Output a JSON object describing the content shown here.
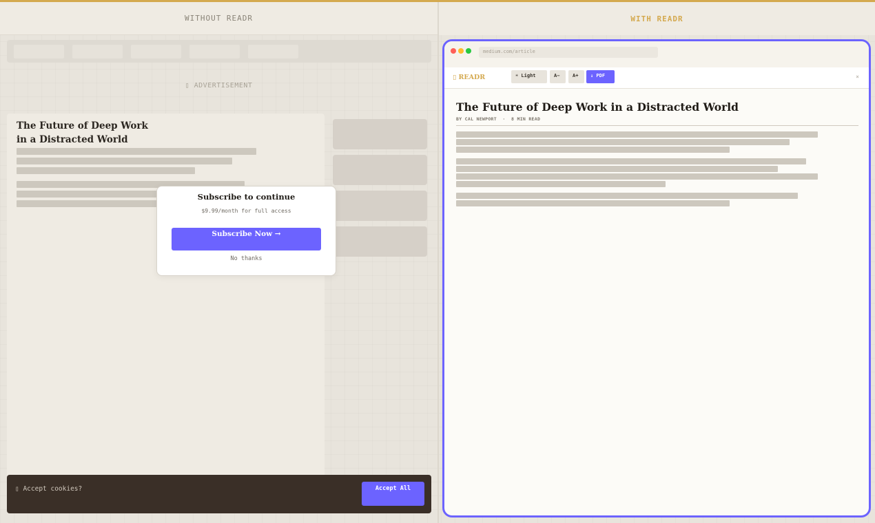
{
  "left": {
    "header": "WITHOUT READR",
    "ad_label": "▯ ADVERTISEMENT",
    "article_title_line1": "The Future of Deep Work",
    "article_title_line2": "in a Distracted World",
    "modal": {
      "title": "Subscribe to continue",
      "subtitle": "$9.99/month for full access",
      "button": "Subscribe Now →",
      "dismiss": "No thanks"
    },
    "cookie": {
      "text": "▯ Accept cookies?",
      "button": "Accept All"
    }
  },
  "right": {
    "header": "WITH READR",
    "url": "medium.com/article",
    "logo": "▯ READR",
    "toolbar": {
      "theme": "☀ Light",
      "font_down": "A−",
      "font_up": "A+",
      "pdf": "↓ PDF",
      "close": "×"
    },
    "title": "The Future of Deep Work in a Distracted World",
    "meta": "BY CAL NEWPORT  ·  8 MIN READ"
  },
  "colors": {
    "accent": "#6c63ff",
    "gold": "#d4a94f",
    "cookie_bg": "#3a2f27"
  }
}
